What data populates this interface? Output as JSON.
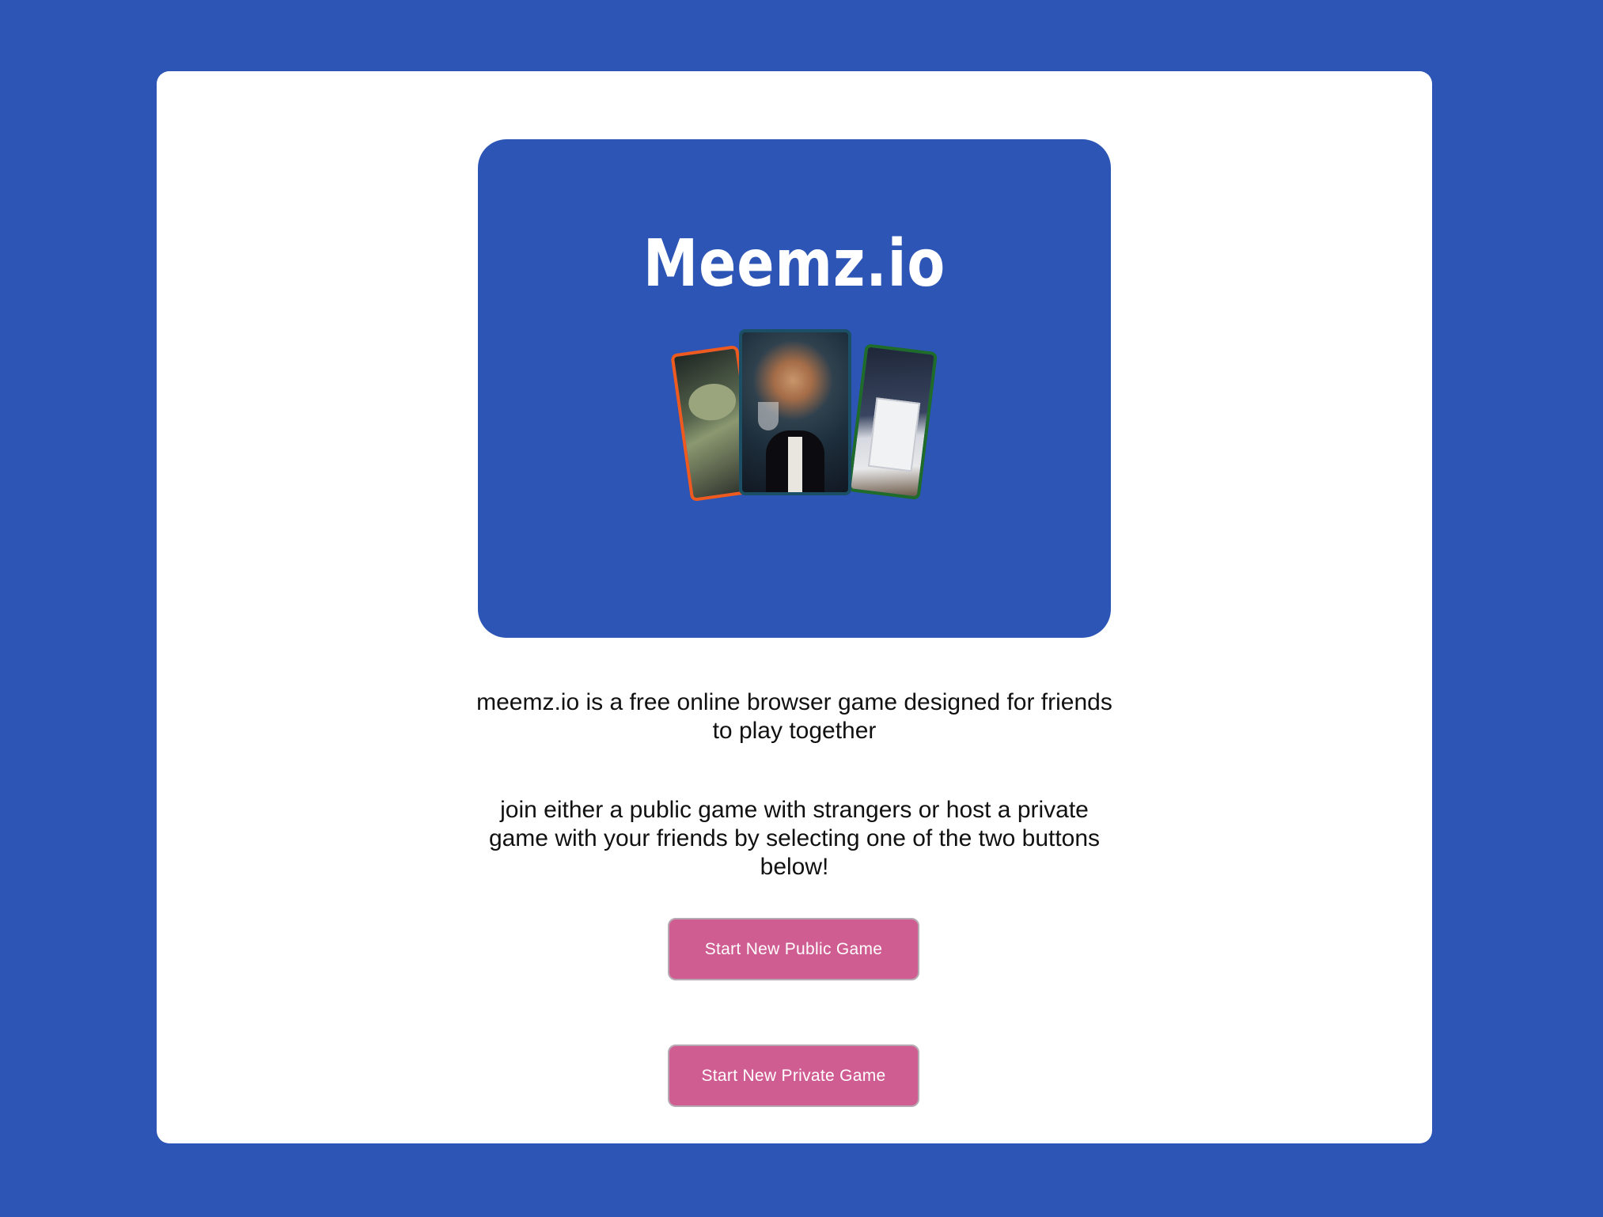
{
  "hero": {
    "logo_text": "Meemz.io"
  },
  "intro": {
    "line1": "meemz.io is a free online browser game designed for friends to play together",
    "line2": "join either a public game with strangers or host a private game with your friends by selecting one of the two buttons below!"
  },
  "actions": {
    "public_label": "Start New Public Game",
    "private_label": "Start New Private Game"
  },
  "colors": {
    "background": "#2d55b5",
    "button": "#d05d91"
  }
}
